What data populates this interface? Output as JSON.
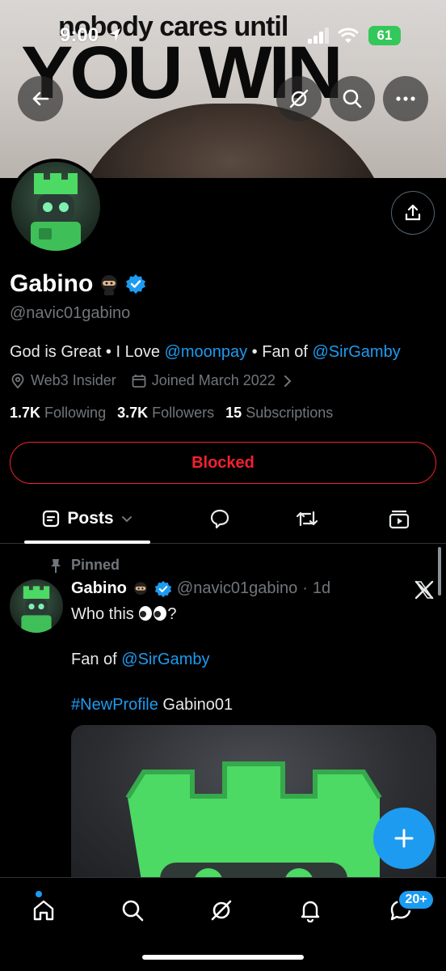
{
  "status_bar": {
    "time": "9:00",
    "battery": "61"
  },
  "banner": {
    "line1": "nobody cares until",
    "line2": "YOU WIN"
  },
  "profile": {
    "name": "Gabino",
    "handle": "@navic01gabino",
    "bio_prefix": "God is Great • I Love ",
    "bio_link1": "@moonpay",
    "bio_mid": " • Fan of ",
    "bio_link2": "@SirGamby",
    "location": "Web3 Insider",
    "joined": "Joined March 2022",
    "following_count": "1.7K",
    "following_label": "Following",
    "followers_count": "3.7K",
    "followers_label": "Followers",
    "subs_count": "15",
    "subs_label": "Subscriptions",
    "blocked_label": "Blocked"
  },
  "tabs": {
    "posts_label": "Posts"
  },
  "post": {
    "pinned_label": "Pinned",
    "author_name": "Gabino",
    "author_handle": "@navic01gabino",
    "dot": "·",
    "time": "1d",
    "line1": "Who this",
    "line1_suffix": "?",
    "line2_prefix": "Fan of ",
    "line2_link": "@SirGamby",
    "line3_link": "#NewProfile",
    "line3_suffix": " Gabino01"
  },
  "bottom_nav": {
    "messages_badge": "20+"
  },
  "colors": {
    "accent": "#1d9bf0",
    "blocked": "#f4212e",
    "muted": "#71767b",
    "castle_green": "#4cd964"
  }
}
